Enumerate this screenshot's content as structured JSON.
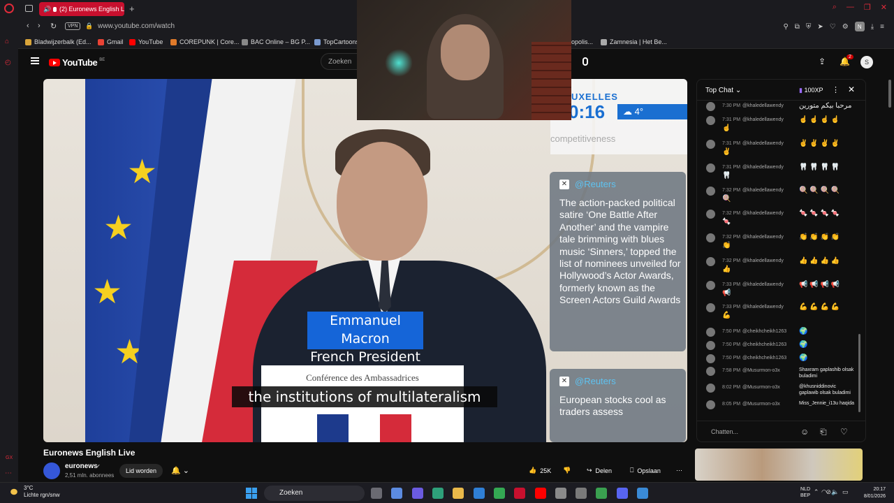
{
  "browser": {
    "tab_title": "(2) Euronews English L",
    "url": "www.youtube.com/watch",
    "vpn": "VPN",
    "profile_initial": "N",
    "bookmarks": [
      {
        "label": "Bladwijzerbalk (Ed...",
        "color": "#d9a53a"
      },
      {
        "label": "Gmail",
        "color": "#ea4335"
      },
      {
        "label": "YouTube",
        "color": "#ff0000"
      },
      {
        "label": "COREPUNK | Core...",
        "color": "#e07a2a"
      },
      {
        "label": "BAC Online – BG P...",
        "color": "#888888"
      },
      {
        "label": "TopCartoons",
        "color": "#7a9ad0"
      },
      {
        "label": "opolis...",
        "color": "#888888"
      },
      {
        "label": "Zamnesia | Het Be...",
        "color": "#aaaaaa"
      }
    ]
  },
  "youtube": {
    "logo_text": "YouTube",
    "region": "BE",
    "search_placeholder": "Zoeken",
    "notification_count": "2",
    "avatar_initial": "S"
  },
  "video": {
    "lower_third_name": "Emmanuel Macron",
    "lower_third_role": "French President",
    "plate_text": "Conférence des Ambassadrices",
    "subtitle": "the institutions of multilateralism",
    "city": "UXELLES",
    "clock": "0:16",
    "temperature": "4°",
    "faded_text": "competitiveness",
    "card1_source": "@Reuters",
    "card1_body": "The action-packed political satire ‘One Battle After Another’ and the vampire tale brimming with blues music ‘Sinners,’ topped the list of nominees unveiled for Hollywood’s Actor Awards, formerly known as the Screen Actors Guild Awards",
    "card2_source": "@Reuters",
    "card2_body": "European stocks cool as traders assess"
  },
  "below": {
    "title": "Euronews English Live",
    "channel": "euronews",
    "subscribers": "2,51 mln. abonnees",
    "join": "Lid worden",
    "likes": "25K",
    "share": "Delen",
    "save": "Opslaan"
  },
  "chat": {
    "title": "Top Chat",
    "xp": "100XP",
    "input_placeholder": "Chatten...",
    "messages": [
      {
        "time": "7:30 PM",
        "user": "@khaledellawendy",
        "text": "مرحبا بيكم متورين",
        "extra": ""
      },
      {
        "time": "7:31 PM",
        "user": "@khaledellawendy",
        "text": "☝️ ☝️ ☝️ ☝️",
        "extra": "☝️"
      },
      {
        "time": "7:31 PM",
        "user": "@khaledellawendy",
        "text": "✌️ ✌️ ✌️ ✌️",
        "extra": "✌️"
      },
      {
        "time": "7:31 PM",
        "user": "@khaledellawendy",
        "text": "🦷 🦷 🦷 🦷",
        "extra": "🦷"
      },
      {
        "time": "7:32 PM",
        "user": "@khaledellawendy",
        "text": "🍭 🍭 🍭 🍭",
        "extra": "🍭"
      },
      {
        "time": "7:32 PM",
        "user": "@khaledellawendy",
        "text": "🍬 🍬 🍬 🍬",
        "extra": "🍬"
      },
      {
        "time": "7:32 PM",
        "user": "@khaledellawendy",
        "text": "👏 👏 👏 👏",
        "extra": "👏"
      },
      {
        "time": "7:32 PM",
        "user": "@khaledellawendy",
        "text": "👍 👍 👍 👍",
        "extra": "👍"
      },
      {
        "time": "7:33 PM",
        "user": "@khaledellawendy",
        "text": "📢 📢 📢 📢",
        "extra": "📢"
      },
      {
        "time": "7:33 PM",
        "user": "@khaledellawendy",
        "text": "💪 💪 💪 💪",
        "extra": "💪"
      },
      {
        "time": "7:50 PM",
        "user": "@cheikhcheikh1263",
        "text": "🌍",
        "extra": ""
      },
      {
        "time": "7:50 PM",
        "user": "@cheikhcheikh1263",
        "text": "🌍",
        "extra": ""
      },
      {
        "time": "7:50 PM",
        "user": "@cheikhcheikh1263",
        "text": "🌍",
        "extra": ""
      },
      {
        "time": "7:58 PM",
        "user": "@Musurmon-o3x",
        "text": "Shaxram gaplashib olsak buladimi",
        "extra": ""
      },
      {
        "time": "8:02 PM",
        "user": "@Musurmon-o3x",
        "text": "@khusniddinovic gaplawib olsak buladimi",
        "extra": ""
      },
      {
        "time": "8:05 PM",
        "user": "@Musurmon-o3x",
        "text": "Miss_Jennie_i13u haqida",
        "extra": ""
      }
    ]
  },
  "taskbar": {
    "temperature": "3°C",
    "weather": "Lichte rgn/snw",
    "search": "Zoeken",
    "lang1": "NLD",
    "lang2": "BEP",
    "time": "20:17",
    "date": "8/01/2026",
    "app_colors": [
      "#6a6a72",
      "#5c8be0",
      "#6b5be0",
      "#2ea07a",
      "#e8b84a",
      "#2f7fd6",
      "#34a853",
      "#c8102e",
      "#ff0000",
      "#8a8a8a",
      "#7a7a7a",
      "#3aa050",
      "#5865f2",
      "#3a8ad6"
    ]
  }
}
